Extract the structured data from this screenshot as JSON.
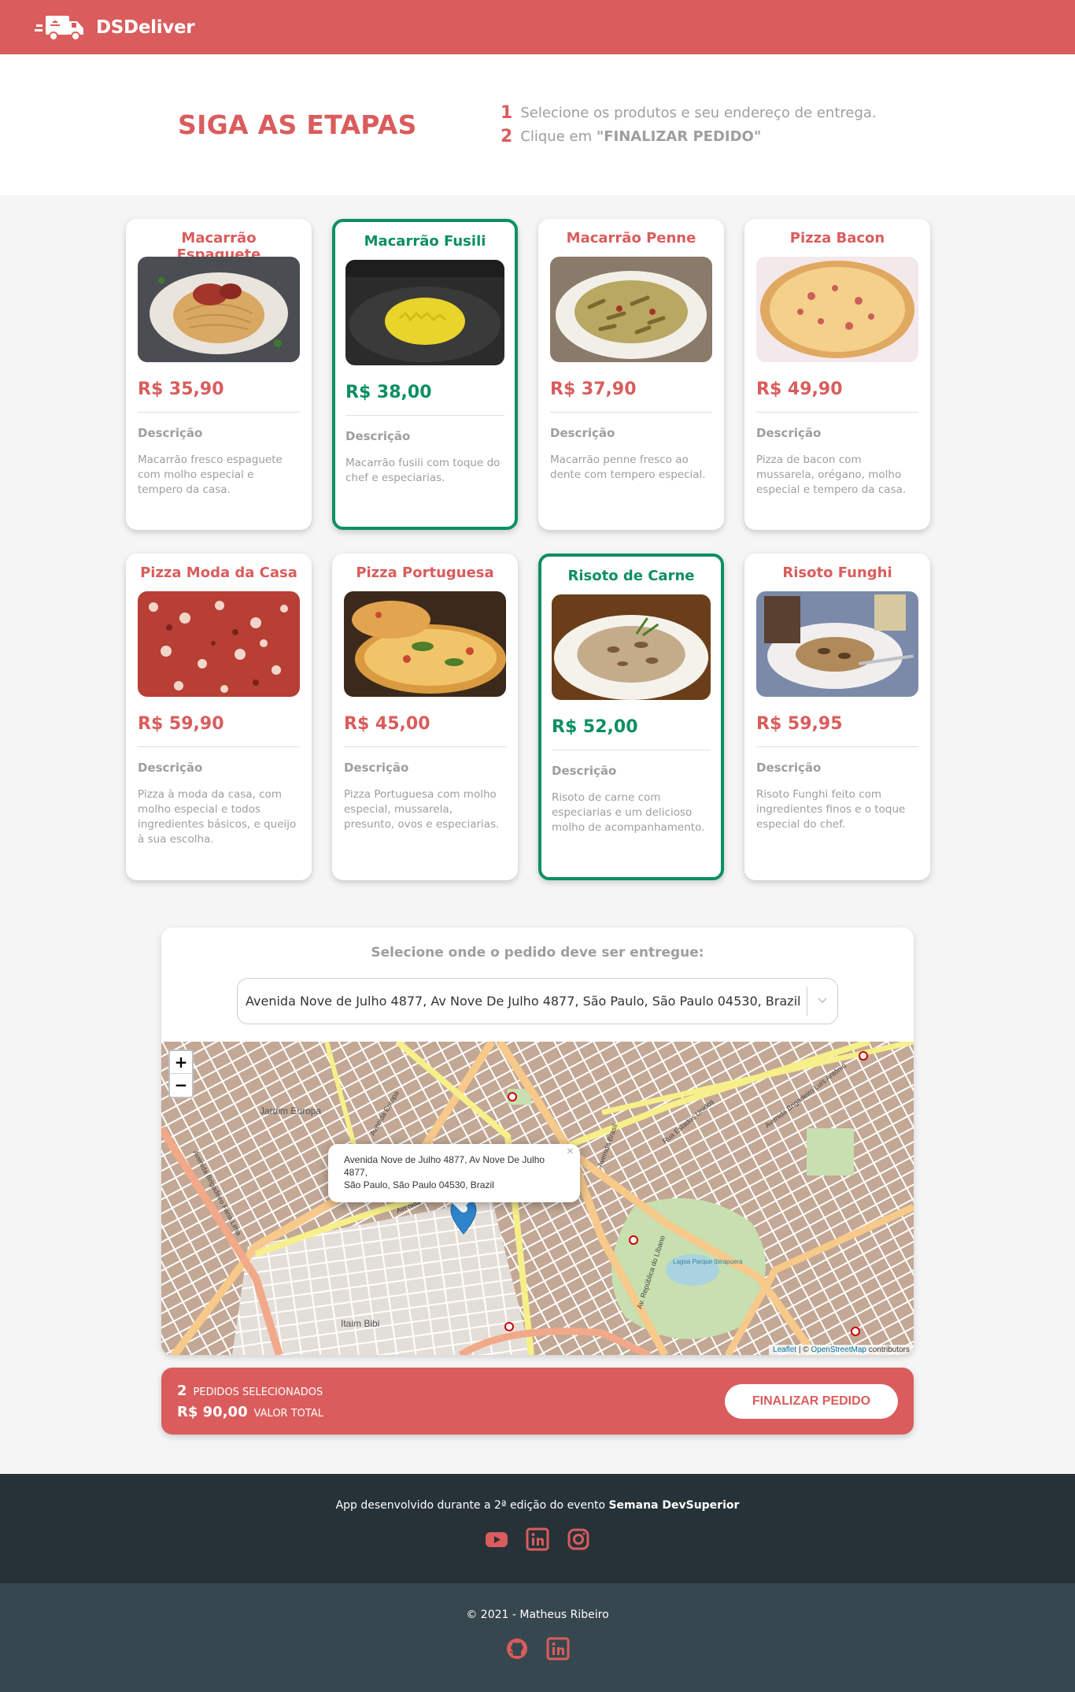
{
  "header": {
    "brand": "DSDeliver",
    "logo_icon": "delivery-truck-icon"
  },
  "steps": {
    "title": "SIGA AS ETAPAS",
    "items": [
      {
        "number": "1",
        "text": "Selecione os produtos e seu endereço de entrega."
      },
      {
        "number": "2",
        "text_before": "Clique em ",
        "text_bold": "\"FINALIZAR PEDIDO\""
      }
    ]
  },
  "products": [
    {
      "name": "Macarrão Espaguete",
      "price": "R$ 35,90",
      "desc_label": "Descrição",
      "description": "Macarrão fresco espaguete com molho especial e tempero da casa.",
      "selected": false
    },
    {
      "name": "Macarrão Fusili",
      "price": "R$ 38,00",
      "desc_label": "Descrição",
      "description": "Macarrão fusili com toque do chef e especiarias.",
      "selected": true
    },
    {
      "name": "Macarrão Penne",
      "price": "R$ 37,90",
      "desc_label": "Descrição",
      "description": "Macarrão penne fresco ao dente com tempero especial.",
      "selected": false
    },
    {
      "name": "Pizza Bacon",
      "price": "R$ 49,90",
      "desc_label": "Descrição",
      "description": "Pizza de bacon com mussarela, orégano, molho especial e tempero da casa.",
      "selected": false
    },
    {
      "name": "Pizza Moda da Casa",
      "price": "R$ 59,90",
      "desc_label": "Descrição",
      "description": "Pizza à moda da casa, com molho especial e todos ingredientes básicos, e queijo à sua escolha.",
      "selected": false
    },
    {
      "name": "Pizza Portuguesa",
      "price": "R$ 45,00",
      "desc_label": "Descrição",
      "description": "Pizza Portuguesa com molho especial, mussarela, presunto, ovos e especiarias.",
      "selected": false
    },
    {
      "name": "Risoto de Carne",
      "price": "R$ 52,00",
      "desc_label": "Descrição",
      "description": "Risoto de carne com especiarias e um delicioso molho de acompanhamento.",
      "selected": true
    },
    {
      "name": "Risoto Funghi",
      "price": "R$ 59,95",
      "desc_label": "Descrição",
      "description": "Risoto Funghi feito com ingredientes finos e o toque especial do chef.",
      "selected": false
    }
  ],
  "location": {
    "title": "Selecione onde o pedido deve ser entregue:",
    "selected_address": "Avenida Nove de Julho 4877, Av Nove De Julho 4877, São Paulo, São Paulo 04530, Brazil",
    "zoom_in": "+",
    "zoom_out": "−",
    "popup_line1": "Avenida Nove de Julho 4877, Av Nove De Julho 4877,",
    "popup_line2": "São Paulo, São Paulo 04530, Brazil",
    "popup_close": "×",
    "attribution_leaflet": "Leaflet",
    "attribution_sep": " | © ",
    "attribution_osm": "OpenStreetMap",
    "attribution_contrib": " contributors",
    "map_labels": {
      "jardim_europa": "Jardim Europa",
      "itaim_bibi": "Itaim Bibi",
      "lagoa": "Lagoa Parque Ibirapuera",
      "av_nove_julho": "Avenida 9 de Julho",
      "av_brasil": "Avenida Brasil",
      "av_europa": "Avenida Europa",
      "av_faria_lima": "Avenida Brigadeiro Faria Lima",
      "rua_estados_unidos": "Rua Estados Unidos",
      "av_luis_antonio": "Avenida Brigadeiro Luís Antônio",
      "av_republica_libano": "Av. República do Líbano"
    }
  },
  "summary": {
    "count": "2",
    "count_label": "PEDIDOS SELECIONADOS",
    "total": "R$ 90,00",
    "total_label": "VALOR TOTAL",
    "button": "FINALIZAR PEDIDO"
  },
  "footer": {
    "text_before": "App desenvolvido durante a 2ª edição do evento ",
    "text_bold": "Semana DevSuperior",
    "social_icons": [
      "youtube-icon",
      "linkedin-icon",
      "instagram-icon"
    ],
    "copyright": "© 2021 - Matheus Ribeiro",
    "author_icons": [
      "github-icon",
      "linkedin-icon"
    ]
  },
  "colors": {
    "primary": "#da5c5c",
    "selected": "#0b8f63",
    "footer_dark": "#263238",
    "footer_light": "#37474f"
  }
}
